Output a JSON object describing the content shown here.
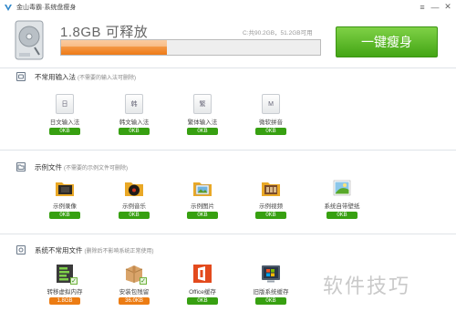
{
  "window": {
    "title": "金山毒霸·系统盘瘦身",
    "logo": "kingsoft-v-logo",
    "controls": [
      "≡",
      "—",
      "✕"
    ]
  },
  "header": {
    "free_space": "1.8GB 可释放",
    "disk_info": "C:共90.2GB，51.2GB可用",
    "usage_fraction": 0.41,
    "slim_button": "一键瘦身",
    "accent": "#4caf1a",
    "bar_color": "#ee7a17"
  },
  "sections": [
    {
      "title": "不常用输入法",
      "subtitle": "(不需要的输入法可删除)",
      "icon": "keyboard-icon",
      "items": [
        {
          "label": "日文输入法",
          "size": "0KB",
          "glyph": "日"
        },
        {
          "label": "韩文输入法",
          "size": "0KB",
          "glyph": "韩"
        },
        {
          "label": "繁体输入法",
          "size": "0KB",
          "glyph": "繁"
        },
        {
          "label": "微软拼音",
          "size": "0KB",
          "glyph": "M"
        }
      ]
    },
    {
      "title": "示例文件",
      "subtitle": "(不需要的示例文件可删除)",
      "icon": "folder-icon",
      "items": [
        {
          "label": "示例录像",
          "size": "0KB",
          "icon": "video-folder-icon"
        },
        {
          "label": "示例音乐",
          "size": "0KB",
          "icon": "music-folder-icon"
        },
        {
          "label": "示例图片",
          "size": "0KB",
          "icon": "picture-folder-icon"
        },
        {
          "label": "示例视频",
          "size": "0KB",
          "icon": "film-folder-icon"
        },
        {
          "label": "系统自带壁纸",
          "size": "0KB",
          "icon": "wallpaper-icon"
        }
      ]
    },
    {
      "title": "系统不常用文件",
      "subtitle": "(删除后不影响系统正常使用)",
      "icon": "gear-file-icon",
      "items": [
        {
          "label": "转移虚拟内存",
          "size": "1.8GB",
          "icon": "memory-icon",
          "checked": true
        },
        {
          "label": "安装包残留",
          "size": "36.0KB",
          "icon": "package-icon",
          "checked": true
        },
        {
          "label": "Office缓存",
          "size": "0KB",
          "icon": "office-icon",
          "checked": false
        },
        {
          "label": "旧版系统缓存",
          "size": "0KB",
          "icon": "windows-icon",
          "checked": false
        }
      ]
    }
  ],
  "watermark": "软件技巧"
}
